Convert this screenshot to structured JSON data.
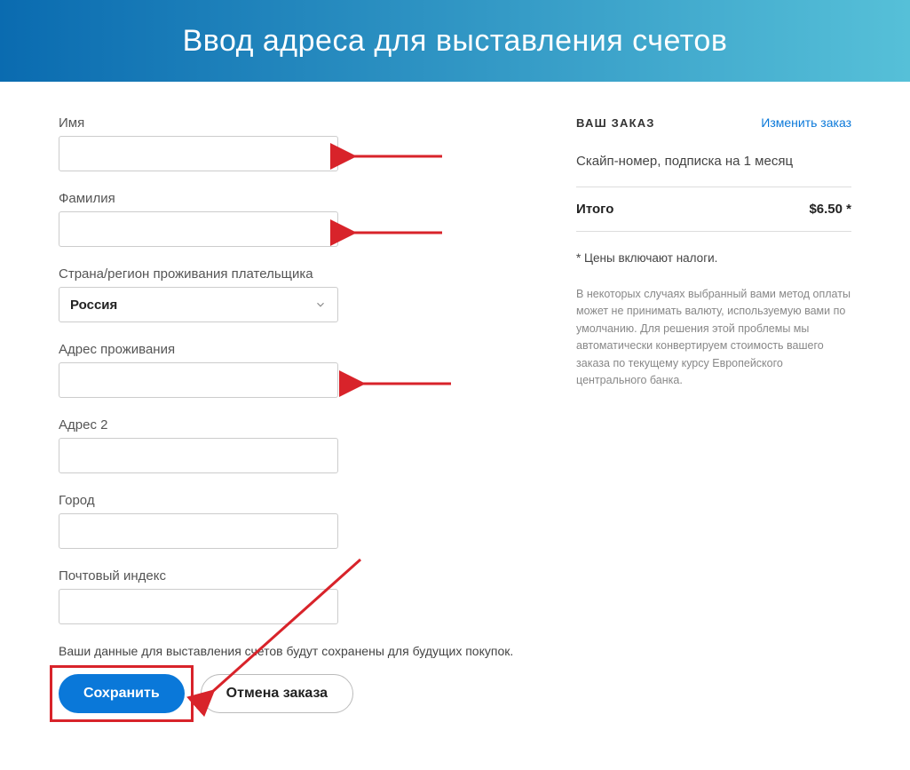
{
  "header": {
    "title": "Ввод адреса для выставления счетов"
  },
  "form": {
    "first_name_label": "Имя",
    "last_name_label": "Фамилия",
    "country_label": "Страна/регион проживания плательщика",
    "country_value": "Россия",
    "address_label": "Адрес проживания",
    "address2_label": "Адрес 2",
    "city_label": "Город",
    "postal_label": "Почтовый индекс",
    "save_note": "Ваши данные для выставления счетов будут сохранены для будущих покупок.",
    "save_button": "Сохранить",
    "cancel_button": "Отмена заказа"
  },
  "order": {
    "heading": "ВАШ ЗАКАЗ",
    "change_link": "Изменить заказ",
    "item": "Скайп-номер, подписка на 1 месяц",
    "total_label": "Итого",
    "total_value": "$6.50 *",
    "tax_note": "* Цены включают налоги.",
    "currency_note": "В некоторых случаях выбранный вами метод оплаты может не принимать валюту, используемую вами по умолчанию. Для решения этой проблемы мы автоматически конвертируем стоимость вашего заказа по текущему курсу Европейского центрального банка."
  }
}
